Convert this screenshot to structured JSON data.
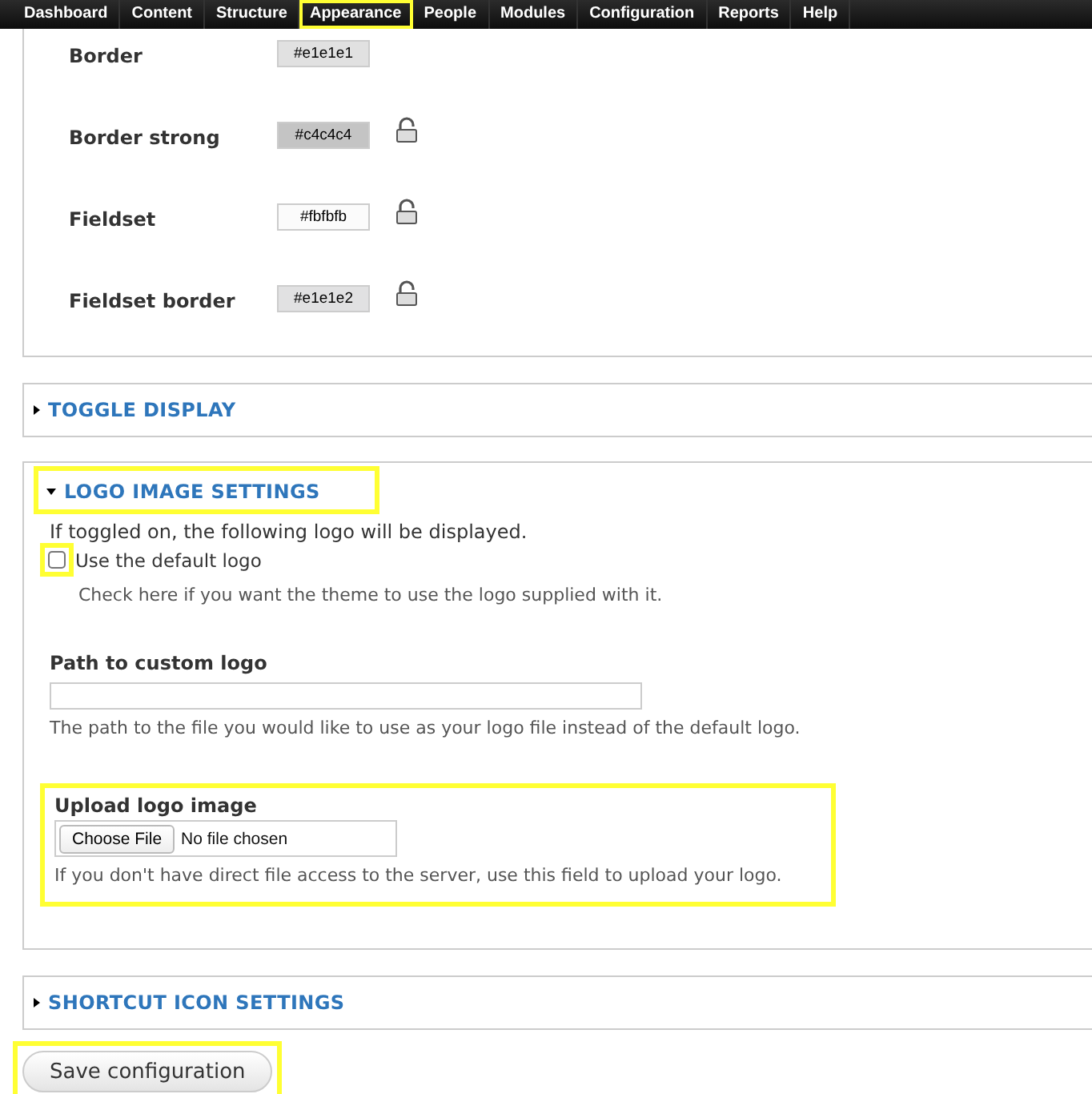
{
  "nav": [
    {
      "label": "Dashboard",
      "highlighted": false
    },
    {
      "label": "Content",
      "highlighted": false
    },
    {
      "label": "Structure",
      "highlighted": false
    },
    {
      "label": "Appearance",
      "highlighted": true
    },
    {
      "label": "People",
      "highlighted": false
    },
    {
      "label": "Modules",
      "highlighted": false
    },
    {
      "label": "Configuration",
      "highlighted": false
    },
    {
      "label": "Reports",
      "highlighted": false
    },
    {
      "label": "Help",
      "highlighted": false
    }
  ],
  "colors": [
    {
      "label": "Border",
      "value": "#e1e1e1",
      "color": "#e1e1e1",
      "lock_above": false
    },
    {
      "label": "Border strong",
      "value": "#c4c4c4",
      "color": "#c4c4c4",
      "lock_above": true
    },
    {
      "label": "Fieldset",
      "value": "#fbfbfb",
      "color": "#fbfbfb",
      "lock_above": true
    },
    {
      "label": "Fieldset border",
      "value": "#e1e1e2",
      "color": "#e1e1e2",
      "lock_above": true
    }
  ],
  "toggle_display": {
    "title": "TOGGLE DISPLAY",
    "expanded": false
  },
  "logo_settings": {
    "title": "LOGO IMAGE SETTINGS",
    "expanded": true,
    "highlighted": true,
    "intro": "If toggled on, the following logo will be displayed.",
    "default_logo": {
      "label": "Use the default logo",
      "checked": false,
      "highlighted": true,
      "description": "Check here if you want the theme to use the logo supplied with it."
    },
    "path": {
      "label": "Path to custom logo",
      "description": "The path to the file you would like to use as your logo file instead of the default logo."
    },
    "upload": {
      "label": "Upload logo image",
      "button": "Choose File",
      "status": "No file chosen",
      "description": "If you don't have direct file access to the server, use this field to upload your logo.",
      "highlighted": true
    }
  },
  "shortcut_icon": {
    "title": "SHORTCUT ICON SETTINGS",
    "expanded": false
  },
  "save_button": {
    "label": "Save configuration",
    "highlighted": true
  }
}
